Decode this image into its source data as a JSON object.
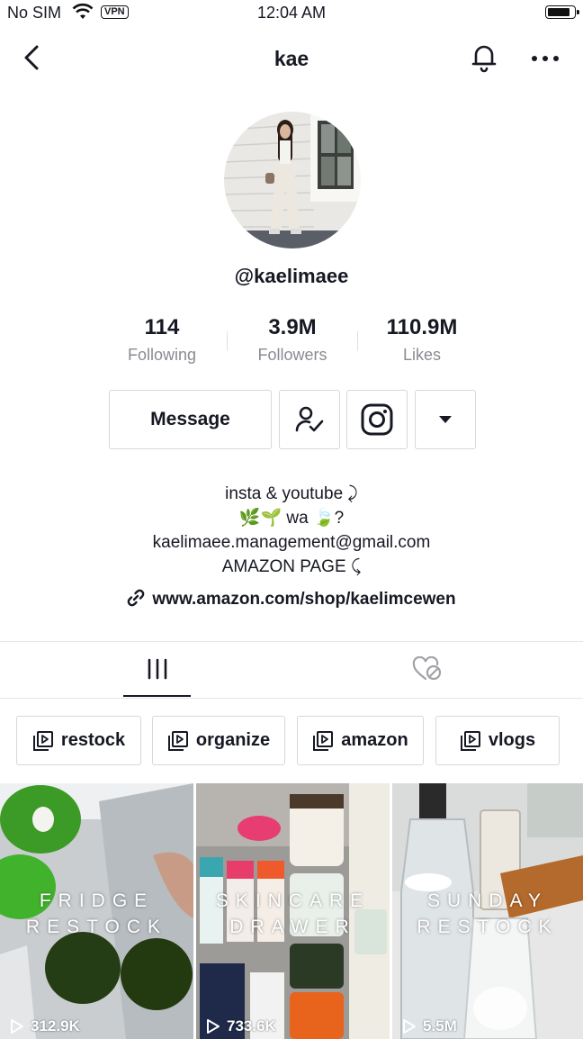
{
  "status_bar": {
    "carrier": "No SIM",
    "vpn": "VPN",
    "time": "12:04 AM"
  },
  "nav": {
    "title": "kae"
  },
  "profile": {
    "handle": "@kaelimaee",
    "stats": [
      {
        "value": "114",
        "label": "Following"
      },
      {
        "value": "3.9M",
        "label": "Followers"
      },
      {
        "value": "110.9M",
        "label": "Likes"
      }
    ],
    "message_label": "Message",
    "bio_lines": [
      "insta & youtube ⤸",
      "🌿🌱 wa 🍃?",
      "kaelimaee.management@gmail.com",
      "AMAZON PAGE ⤹"
    ],
    "link": "www.amazon.com/shop/kaelimcewen"
  },
  "playlists": [
    "restock",
    "organize",
    "amazon",
    "vlogs"
  ],
  "videos": [
    {
      "caption_1": "FRIDGE",
      "caption_2": "RESTOCK",
      "views": "312.9K"
    },
    {
      "caption_1": "SKINCARE",
      "caption_2": "DRAWER",
      "views": "733.6K"
    },
    {
      "caption_1": "SUNDAY",
      "caption_2": "RESTOCK",
      "views": "5.5M"
    }
  ]
}
